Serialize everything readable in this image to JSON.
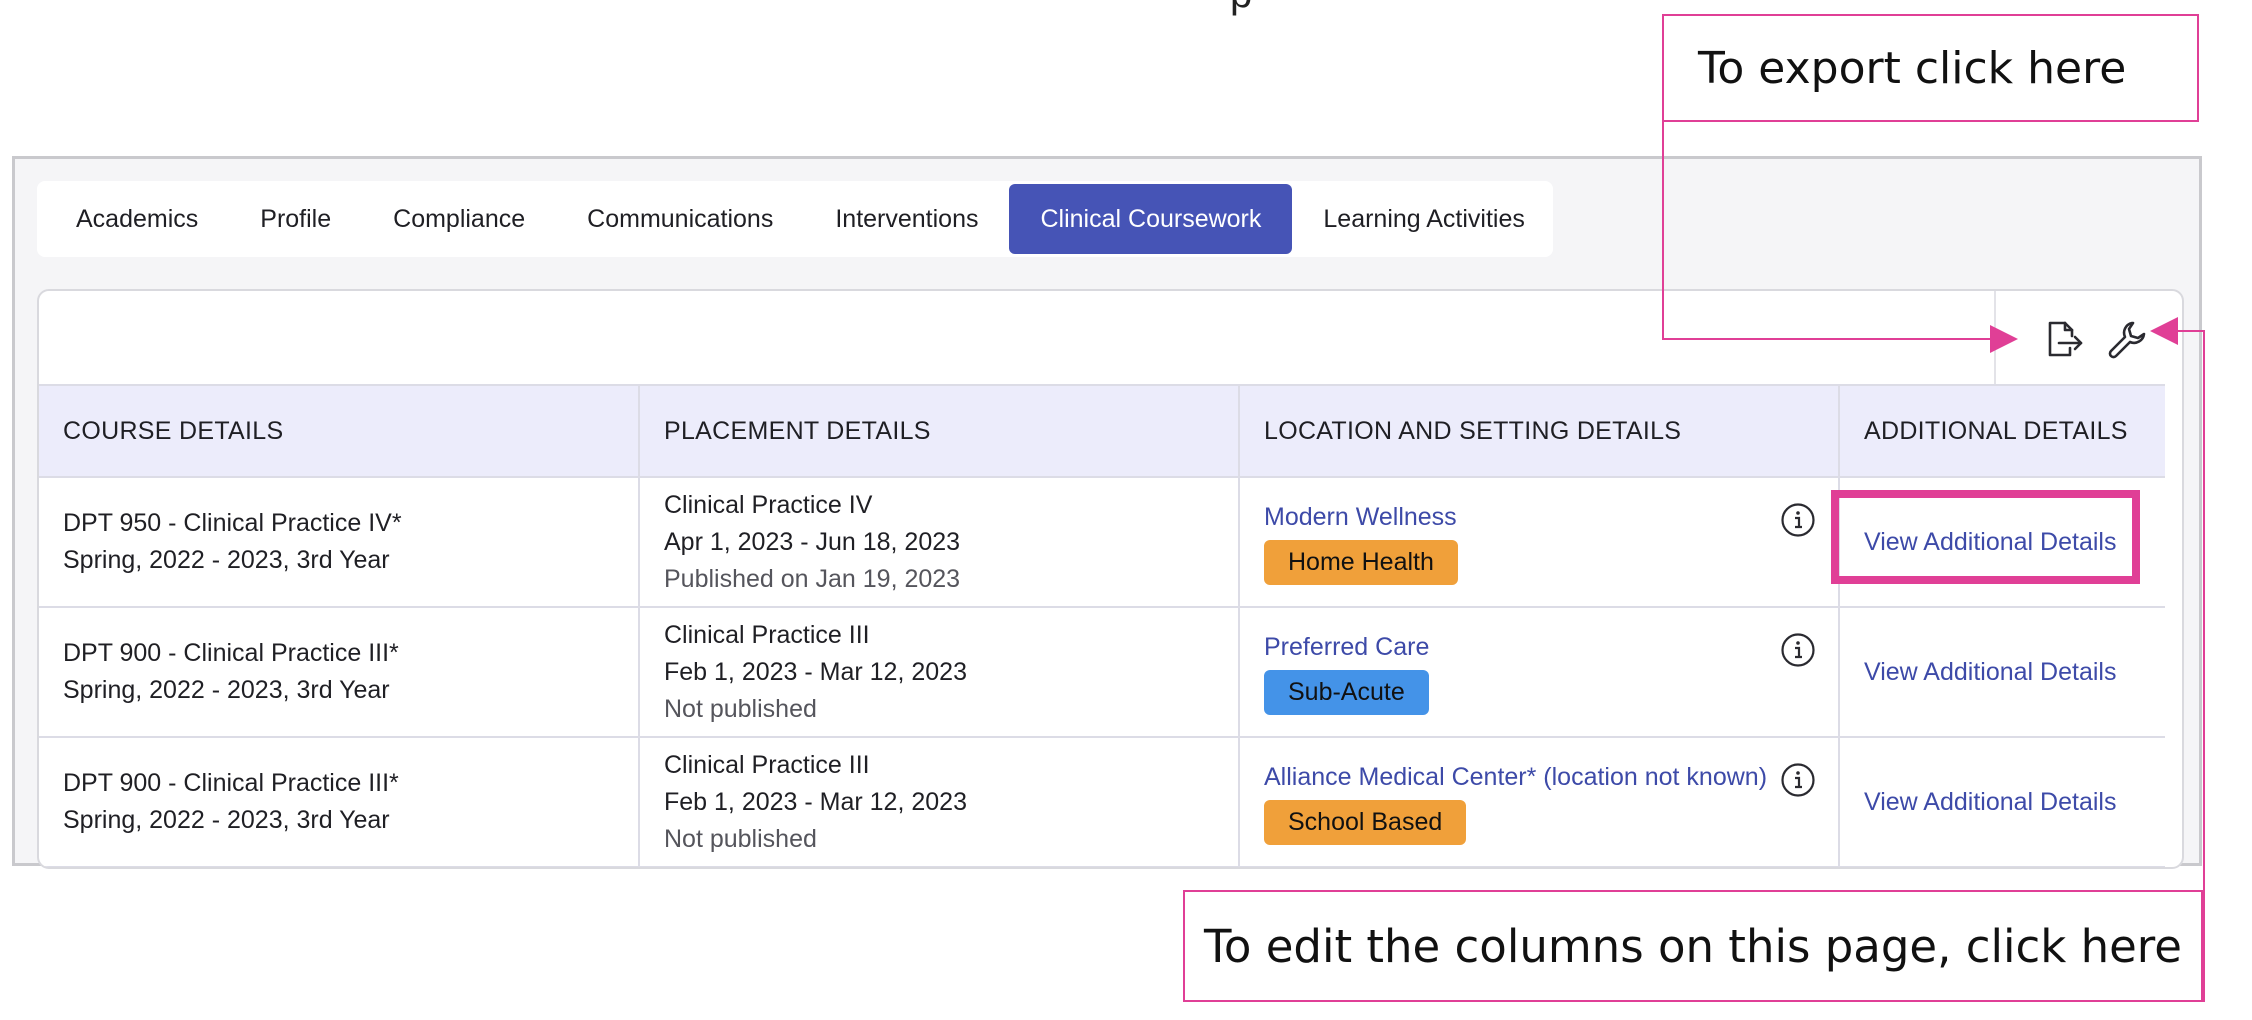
{
  "annotations": {
    "export_callout": "To export click here",
    "edit_callout": "To edit the columns on this page, click here",
    "top_cut_glyph": "p",
    "accent_color": "#e03f96"
  },
  "tabs": [
    {
      "label": "Academics"
    },
    {
      "label": "Profile"
    },
    {
      "label": "Compliance"
    },
    {
      "label": "Communications"
    },
    {
      "label": "Interventions"
    },
    {
      "label": "Clinical Coursework",
      "active": true
    },
    {
      "label": "Learning Activities"
    }
  ],
  "toolbar": {
    "export_icon": "export-file-icon",
    "settings_icon": "wrench-icon"
  },
  "table": {
    "headers": [
      "COURSE DETAILS",
      "PLACEMENT DETAILS",
      "LOCATION AND SETTING DETAILS",
      "ADDITIONAL DETAILS"
    ],
    "rows": [
      {
        "course_line1": "DPT 950 - Clinical Practice IV*",
        "course_line2": "Spring, 2022 - 2023, 3rd Year",
        "placement_title": "Clinical Practice IV",
        "placement_dates": "Apr 1, 2023 - Jun 18, 2023",
        "placement_status": "Published on Jan 19, 2023",
        "location": "Modern Wellness",
        "setting": "Home Health",
        "setting_color": "#f0a03a",
        "action": "View Additional Details"
      },
      {
        "course_line1": "DPT 900 - Clinical Practice III*",
        "course_line2": "Spring, 2022 - 2023, 3rd Year",
        "placement_title": "Clinical Practice III",
        "placement_dates": "Feb 1, 2023 - Mar 12, 2023",
        "placement_status": "Not published",
        "location": "Preferred Care",
        "setting": "Sub-Acute",
        "setting_color": "#4493e8",
        "action": "View Additional Details"
      },
      {
        "course_line1": "DPT 900 - Clinical Practice III*",
        "course_line2": "Spring, 2022 - 2023, 3rd Year",
        "placement_title": "Clinical Practice III",
        "placement_dates": "Feb 1, 2023 - Mar 12, 2023",
        "placement_status": "Not published",
        "location": "Alliance Medical Center* (location not known)",
        "setting": "School Based",
        "setting_color": "#f0a03a",
        "action": "View Additional Details"
      }
    ]
  }
}
